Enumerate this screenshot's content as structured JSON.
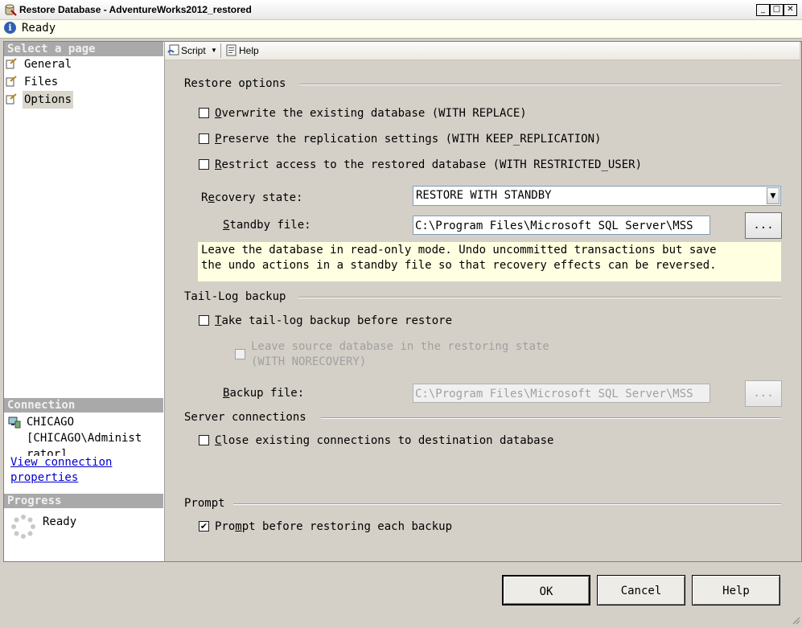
{
  "window": {
    "title": "Restore Database - AdventureWorks2012_restored",
    "buttons": [
      "_",
      "□",
      "✕"
    ]
  },
  "status": {
    "text": "Ready"
  },
  "left": {
    "select_page_header": "Select a page",
    "pages": [
      {
        "label": "General"
      },
      {
        "label": "Files"
      },
      {
        "label": "Options",
        "selected": true
      }
    ],
    "connection_header": "Connection",
    "server": "CHICAGO",
    "user": "[CHICAGO\\Administ",
    "user_cont": "rator]",
    "view_link_1": "View connection ",
    "view_link_2": "properties",
    "progress_header": "Progress",
    "progress_text": "Ready"
  },
  "toolbar": {
    "script_label": "Script",
    "help_label": "Help"
  },
  "restore_options": {
    "header": "Restore options",
    "overwrite": {
      "accel": "O",
      "rest": "verwrite the existing database (WITH REPLACE)",
      "checked": false
    },
    "preserve": {
      "accel": "P",
      "rest": "reserve the replication settings (WITH KEEP_REPLICATION)",
      "checked": false
    },
    "restrict": {
      "accel": "R",
      "rest": "estrict access to the restored database (WITH RESTRICTED_USER)",
      "checked": false
    },
    "recovery_label_pre": "R",
    "recovery_label_accel": "e",
    "recovery_label_post": "covery state:",
    "recovery_value": "RESTORE WITH STANDBY",
    "standby_accel": "S",
    "standby_rest": "tandby file:",
    "standby_value": "C:\\Program Files\\Microsoft SQL Server\\MSS",
    "ellipsis": "...",
    "description_1": "Leave the database in read-only mode. Undo uncommitted transactions but save",
    "description_2": "the undo actions in a standby file so that recovery effects can be reversed."
  },
  "tail_log": {
    "header": "Tail-Log backup",
    "take": {
      "accel": "T",
      "rest": "ake tail-log backup before restore",
      "checked": false
    },
    "leave_1": "Leave source database in the restoring state",
    "leave_2": "(WITH NORECOVERY)",
    "backup_accel": "B",
    "backup_rest": "ackup file:",
    "backup_value": "C:\\Program Files\\Microsoft SQL Server\\MSS",
    "ellipsis": "..."
  },
  "server_connections": {
    "header": "Server connections",
    "close": {
      "accel": "C",
      "rest": "lose existing connections to destination database",
      "checked": false
    }
  },
  "prompt": {
    "header": "Prompt",
    "prompt_pre": "Pro",
    "prompt_accel": "m",
    "prompt_post": "pt before restoring each backup",
    "checked": true,
    "check_glyph": "✔"
  },
  "buttons": {
    "ok": "OK",
    "cancel": "Cancel",
    "help": "Help"
  },
  "colors": {
    "title_bar": "#f4f4f4",
    "info_band": "#fffff0",
    "description_bg": "#ffffe1",
    "link": "#0000cc",
    "section_header": "#a9a9a9"
  }
}
